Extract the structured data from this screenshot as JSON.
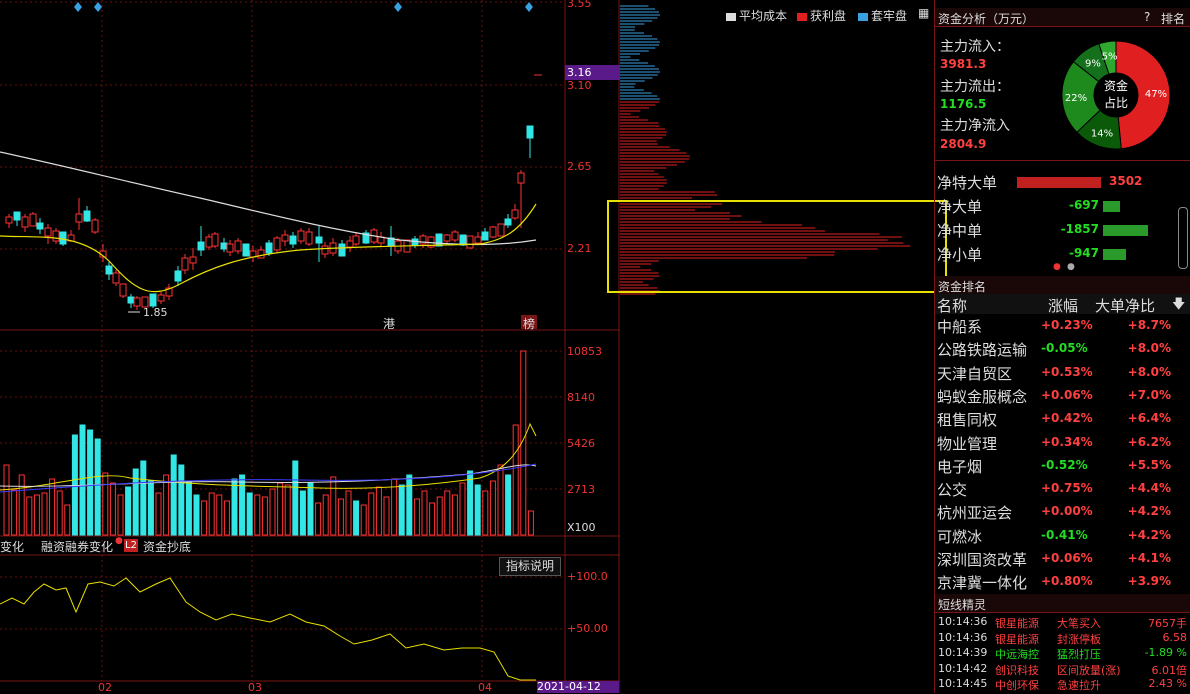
{
  "price_axis": [
    "3.55",
    "3.16",
    "3.10",
    "2.65",
    "2.21"
  ],
  "low_marker": "1.85",
  "event_labels": {
    "gang": "港",
    "bang": "榜"
  },
  "vol_axis": [
    "10853",
    "8140",
    "5426",
    "2713",
    "X100"
  ],
  "tabs": [
    "变化",
    "融资融券变化",
    "L2",
    "资金抄底"
  ],
  "indicator_btn": "指标说明",
  "ind_axis": [
    "+100.0",
    "+50.00"
  ],
  "months": [
    "02",
    "03",
    "04"
  ],
  "date_label": "2021-04-12",
  "profile_legend": {
    "avg_cost": "平均成本",
    "profit": "获利盘",
    "trapped": "套牢盘"
  },
  "fund": {
    "title": "资金分析（万元）",
    "help": "?",
    "rank_btn": "排名",
    "inflow_label": "主力流入：",
    "inflow": "3981.3",
    "outflow_label": "主力流出：",
    "outflow": "1176.5",
    "net_label": "主力净流入",
    "net": "2804.9",
    "donut_center": [
      "资金",
      "占比"
    ],
    "pie": [
      {
        "label": "47%",
        "value": 47,
        "color": "#e02020"
      },
      {
        "label": "14%",
        "value": 14,
        "color": "#0a5a0a"
      },
      {
        "label": "22%",
        "value": 22,
        "color": "#1e8a1e"
      },
      {
        "label": "9%",
        "value": 9,
        "color": "#14701a"
      },
      {
        "label": "5%",
        "value": 5,
        "color": "#2fa82f"
      }
    ],
    "bars": [
      {
        "label": "净特大单",
        "value": "3502",
        "frac": 1.0,
        "color": "#c02020"
      },
      {
        "label": "净大单",
        "value": "-697",
        "frac": 0.2,
        "color": "#2a9a2a"
      },
      {
        "label": "净中单",
        "value": "-1857",
        "frac": 0.53,
        "color": "#2a9a2a"
      },
      {
        "label": "净小单",
        "value": "-947",
        "frac": 0.27,
        "color": "#2a9a2a"
      }
    ]
  },
  "ranking": {
    "title": "资金排名",
    "col_name": "名称",
    "col_chg": "涨幅",
    "col_ratio": "大单净比",
    "rows": [
      {
        "name": "中船系",
        "chg": "+0.23%",
        "ratio": "+8.7%",
        "up": true
      },
      {
        "name": "公路铁路运输",
        "chg": "-0.05%",
        "ratio": "+8.0%",
        "up": false
      },
      {
        "name": "天津自贸区",
        "chg": "+0.53%",
        "ratio": "+8.0%",
        "up": true
      },
      {
        "name": "蚂蚁金服概念",
        "chg": "+0.06%",
        "ratio": "+7.0%",
        "up": true
      },
      {
        "name": "租售同权",
        "chg": "+0.42%",
        "ratio": "+6.4%",
        "up": true
      },
      {
        "name": "物业管理",
        "chg": "+0.34%",
        "ratio": "+6.2%",
        "up": true
      },
      {
        "name": "电子烟",
        "chg": "-0.52%",
        "ratio": "+5.5%",
        "up": false
      },
      {
        "name": "公交",
        "chg": "+0.75%",
        "ratio": "+4.4%",
        "up": true
      },
      {
        "name": "杭州亚运会",
        "chg": "+0.00%",
        "ratio": "+4.2%",
        "up": true
      },
      {
        "name": "可燃冰",
        "chg": "-0.41%",
        "ratio": "+4.2%",
        "up": false
      },
      {
        "name": "深圳国资改革",
        "chg": "+0.06%",
        "ratio": "+4.1%",
        "up": true
      },
      {
        "name": "京津冀一体化",
        "chg": "+0.80%",
        "ratio": "+3.9%",
        "up": true
      }
    ]
  },
  "shortline": {
    "title": "短线精灵",
    "rows": [
      {
        "time": "10:14:36",
        "stock": "银星能源",
        "event": "大笔买入",
        "value": "7657手",
        "color": "#ff4040"
      },
      {
        "time": "10:14:36",
        "stock": "银星能源",
        "event": "封涨停板",
        "value": "6.58",
        "color": "#ff4040"
      },
      {
        "time": "10:14:39",
        "stock": "中远海控",
        "event": "猛烈打压",
        "value": "-1.89 %",
        "color": "#22dd22"
      },
      {
        "time": "10:14:42",
        "stock": "创识科技",
        "event": "区间放量(涨)",
        "value": "6.01倍",
        "color": "#ff4040"
      },
      {
        "time": "10:14:45",
        "stock": "中创环保",
        "event": "急速拉升",
        "value": "2.43 %",
        "color": "#ff4040"
      }
    ]
  }
}
